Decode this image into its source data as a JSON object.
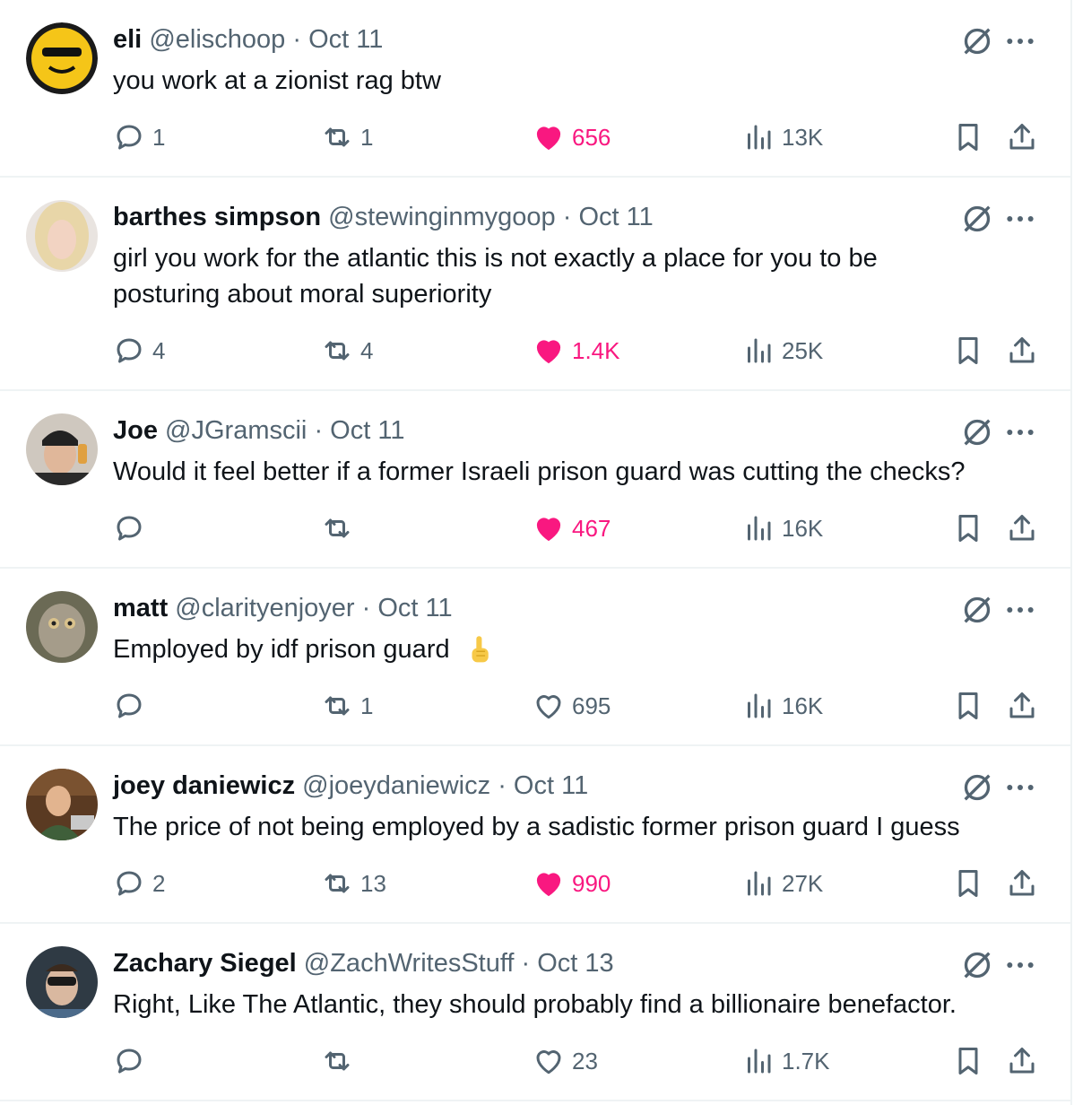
{
  "colors": {
    "like": "#f91880",
    "muted": "#536471",
    "text": "#0f1419",
    "divider": "#eff3f4"
  },
  "tweets": [
    {
      "name": "eli",
      "handle": "@elischoop",
      "sep": "·",
      "date": "Oct 11",
      "text": "you work at a zionist rag btw",
      "replies": "1",
      "retweets": "1",
      "likes": "656",
      "liked": true,
      "views": "13K"
    },
    {
      "name": "barthes simpson",
      "handle": "@stewinginmygoop",
      "sep": "·",
      "date": "Oct 11",
      "text": "girl you work for the atlantic this is not exactly a place for you to be posturing about moral superiority",
      "replies": "4",
      "retweets": "4",
      "likes": "1.4K",
      "liked": true,
      "views": "25K"
    },
    {
      "name": "Joe",
      "handle": "@JGramscii",
      "sep": "·",
      "date": "Oct 11",
      "text": "Would it feel better if a former Israeli prison guard was cutting the checks?",
      "replies": "",
      "retweets": "",
      "likes": "467",
      "liked": true,
      "views": "16K"
    },
    {
      "name": "matt",
      "handle": "@clarityenjoyer",
      "sep": "·",
      "date": "Oct 11",
      "text": "Employed by idf prison guard",
      "emoji": "pointing-up-hand-emoji",
      "replies": "",
      "retweets": "1",
      "likes": "695",
      "liked": false,
      "views": "16K"
    },
    {
      "name": "joey daniewicz",
      "handle": "@joeydaniewicz",
      "sep": "·",
      "date": "Oct 11",
      "text": "The price of not being employed by a sadistic former prison guard I guess",
      "replies": "2",
      "retweets": "13",
      "likes": "990",
      "liked": true,
      "views": "27K"
    },
    {
      "name": "Zachary Siegel",
      "handle": "@ZachWritesStuff",
      "sep": "·",
      "date": "Oct 13",
      "text": "Right, Like The Atlantic, they should probably find a billionaire benefactor.",
      "replies": "",
      "retweets": "",
      "likes": "23",
      "liked": false,
      "views": "1.7K"
    }
  ],
  "icons": {
    "reply": "reply-icon",
    "retweet": "retweet-icon",
    "like": "heart-icon",
    "views": "views-icon",
    "bookmark": "bookmark-icon",
    "share": "share-icon",
    "grok": "grok-icon",
    "more": "more-icon"
  }
}
